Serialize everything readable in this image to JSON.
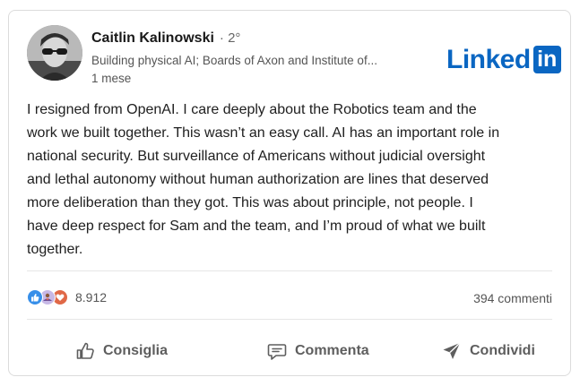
{
  "author": {
    "name": "Caitlin Kalinowski",
    "degree": "· 2°",
    "headline": "Building physical AI; Boards of Axon and Institute of...",
    "time": "1 mese"
  },
  "brand": {
    "logo_word": "Linked",
    "logo_box": "in",
    "color": "#0a66c2"
  },
  "post": {
    "lines": [
      "I resigned from OpenAI. I care deeply about the Robotics team and the",
      "work we built together. This wasn’t an easy call. AI has an important role in",
      "national security. But surveillance of Americans without judicial oversight",
      "and lethal autonomy without human authorization are lines that deserved",
      "more deliberation than they got. This was about principle, not people. I",
      "have deep respect for Sam and the team, and I’m proud of what we built",
      "together."
    ]
  },
  "social": {
    "reaction_icons": [
      "like-icon",
      "support-icon",
      "love-icon"
    ],
    "reactions_count": "8.912",
    "comments_count": "394 commenti"
  },
  "actions": {
    "like_label": "Consiglia",
    "comment_label": "Commenta",
    "share_label": "Condividi"
  }
}
